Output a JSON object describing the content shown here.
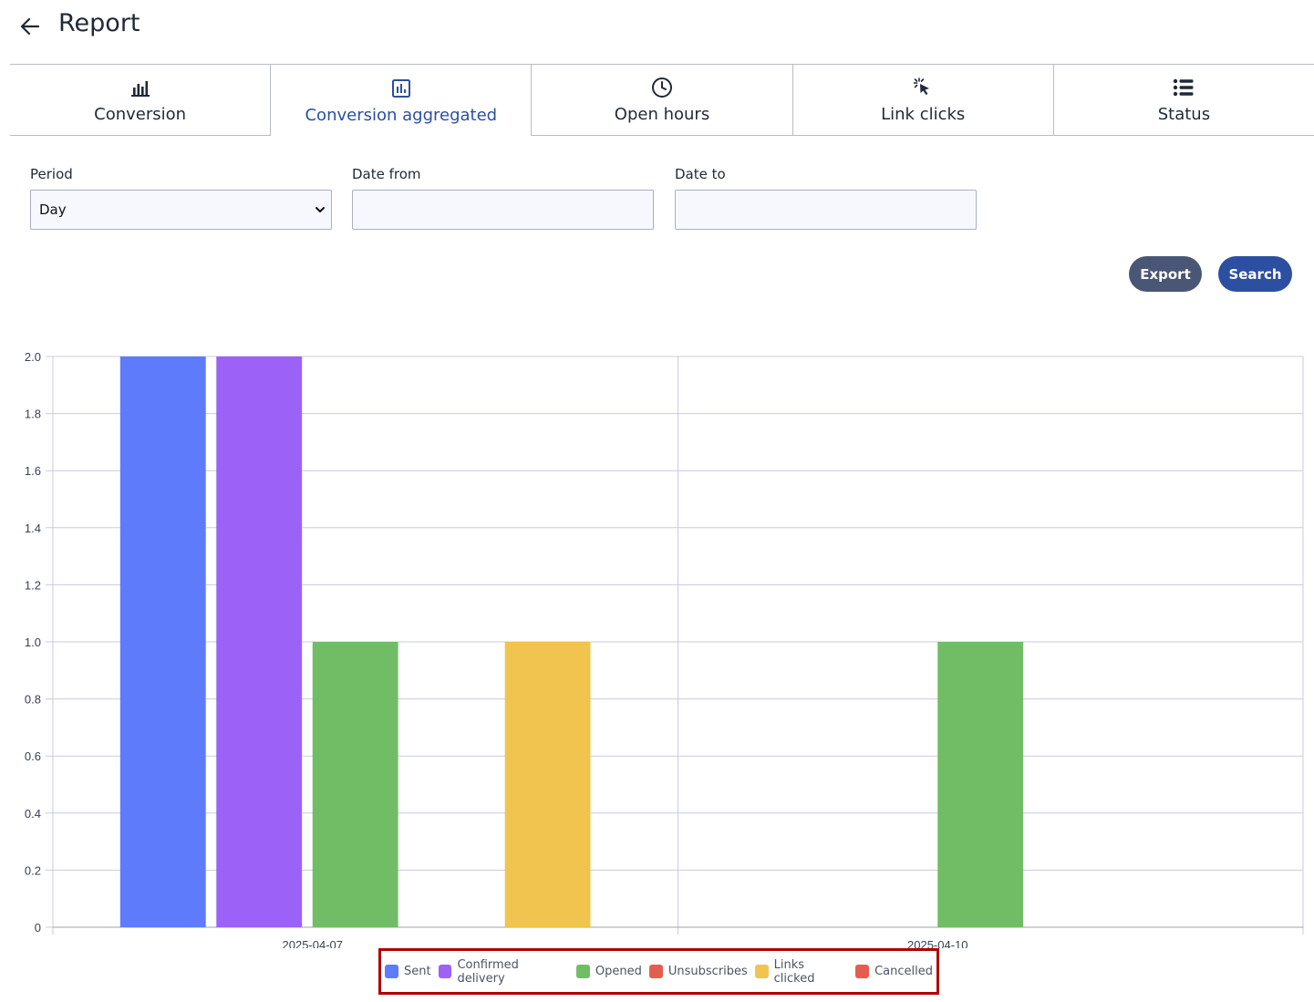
{
  "header": {
    "back_icon": "arrow-left-icon",
    "title": "Report"
  },
  "tabs": [
    {
      "label": "Conversion",
      "icon": "bar-chart-icon",
      "active": false
    },
    {
      "label": "Conversion aggregated",
      "icon": "square-bar-chart-icon",
      "active": true
    },
    {
      "label": "Open hours",
      "icon": "clock-icon",
      "active": false
    },
    {
      "label": "Link clicks",
      "icon": "cursor-click-icon",
      "active": false
    },
    {
      "label": "Status",
      "icon": "list-icon",
      "active": false
    }
  ],
  "filters": {
    "period_label": "Period",
    "period_value": "Day",
    "date_from_label": "Date from",
    "date_from_value": "",
    "date_to_label": "Date to",
    "date_to_value": ""
  },
  "buttons": {
    "export_label": "Export",
    "search_label": "Search"
  },
  "colors": {
    "active_tab": "#2c4fa0",
    "export": "#4a5675",
    "search": "#2d4fa1",
    "legend_highlight": "#b00000"
  },
  "chart_data": {
    "type": "bar",
    "categories": [
      "2025-04-07",
      "2025-04-10"
    ],
    "ylim": [
      0,
      2
    ],
    "yticks": [
      "0",
      "0.2",
      "0.4",
      "0.6",
      "0.8",
      "1.0",
      "1.2",
      "1.4",
      "1.6",
      "1.8",
      "2.0"
    ],
    "grid": true,
    "legend_position": "bottom",
    "series": [
      {
        "name": "Sent",
        "color": "#5e7bfb",
        "values": [
          2,
          0
        ]
      },
      {
        "name": "Confirmed delivery",
        "color": "#9c61f6",
        "values": [
          2,
          0
        ]
      },
      {
        "name": "Opened",
        "color": "#71bd66",
        "values": [
          1,
          1
        ]
      },
      {
        "name": "Unsubscribes",
        "color": "#e45e4f",
        "values": [
          0,
          0
        ]
      },
      {
        "name": "Links clicked",
        "color": "#f0c44f",
        "values": [
          1,
          0
        ]
      },
      {
        "name": "Cancelled",
        "color": "#e45e4f",
        "values": [
          0,
          0
        ]
      }
    ]
  }
}
